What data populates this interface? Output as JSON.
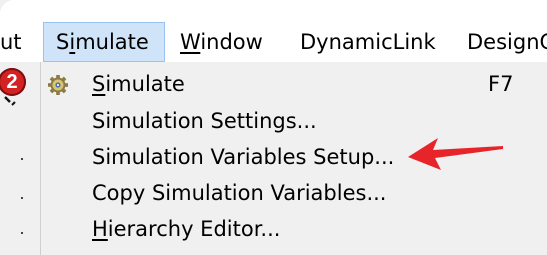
{
  "menubar": {
    "items": [
      {
        "id": "about",
        "label": "ut"
      },
      {
        "id": "simulate",
        "pre": "S",
        "underline": "i",
        "post": "mulate"
      },
      {
        "id": "window",
        "pre": "",
        "underline": "W",
        "post": "indow"
      },
      {
        "id": "dynamiclink",
        "label": "DynamicLink"
      },
      {
        "id": "designer",
        "label": "DesignG"
      }
    ]
  },
  "toolbar": {
    "badge_text": "2",
    "badge_icon": "red-circle-badge-icon"
  },
  "dropdown": {
    "items": [
      {
        "pre": "",
        "underline": "S",
        "post": "imulate",
        "shortcut": "F7",
        "icon": "gear-icon"
      },
      {
        "pre": "Simulation Settings...",
        "underline": "",
        "post": "",
        "shortcut": ""
      },
      {
        "pre": "Simulation Variables Setup...",
        "underline": "",
        "post": "",
        "shortcut": ""
      },
      {
        "pre": "Copy Simulation Variables...",
        "underline": "",
        "post": "",
        "shortcut": ""
      },
      {
        "pre": "",
        "underline": "H",
        "post": "ierarchy Editor...",
        "shortcut": ""
      }
    ]
  },
  "annotation": {
    "color": "#e8242b",
    "icon": "red-arrow-icon"
  },
  "colors": {
    "menubar_active_bg": "#cfe4f9",
    "menubar_active_border": "#99c2ee",
    "menu_bg": "#f0f0f0"
  }
}
